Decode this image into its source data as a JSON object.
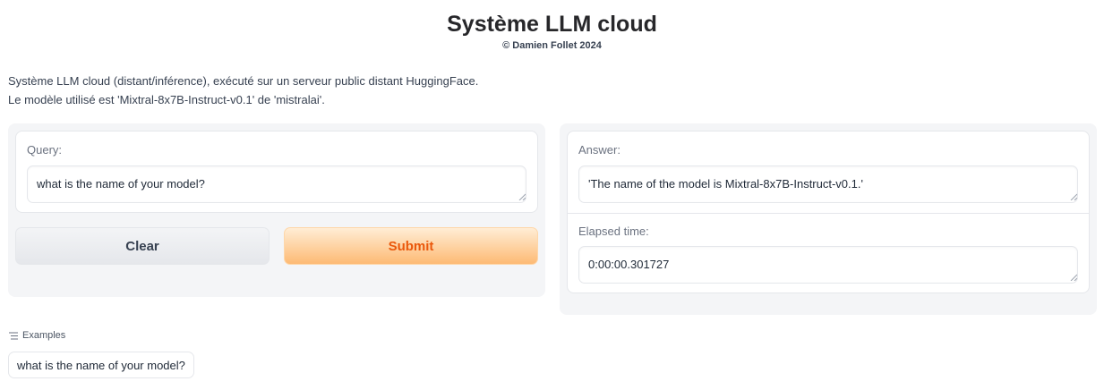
{
  "header": {
    "title": "Système LLM cloud",
    "copyright": "© Damien Follet 2024"
  },
  "description": {
    "line1": "Système LLM cloud (distant/inférence), exécuté sur un serveur public distant HuggingFace.",
    "line2": "Le modèle utilisé est 'Mixtral-8x7B-Instruct-v0.1' de 'mistralai'."
  },
  "query": {
    "label": "Query:",
    "value": "what is the name of your model?"
  },
  "buttons": {
    "clear_label": "Clear",
    "submit_label": "Submit"
  },
  "answer": {
    "label": "Answer:",
    "value": "'The name of the model is Mixtral-8x7B-Instruct-v0.1.'"
  },
  "elapsed": {
    "label": "Elapsed time:",
    "value": "0:00:00.301727"
  },
  "examples": {
    "heading": "Examples",
    "icon": "list-icon",
    "items": [
      "what is the name of your model?"
    ]
  },
  "colors": {
    "submit_text": "#ea580c",
    "submit_bg_end": "#fdba74",
    "panel_bg": "#f4f5f7"
  }
}
